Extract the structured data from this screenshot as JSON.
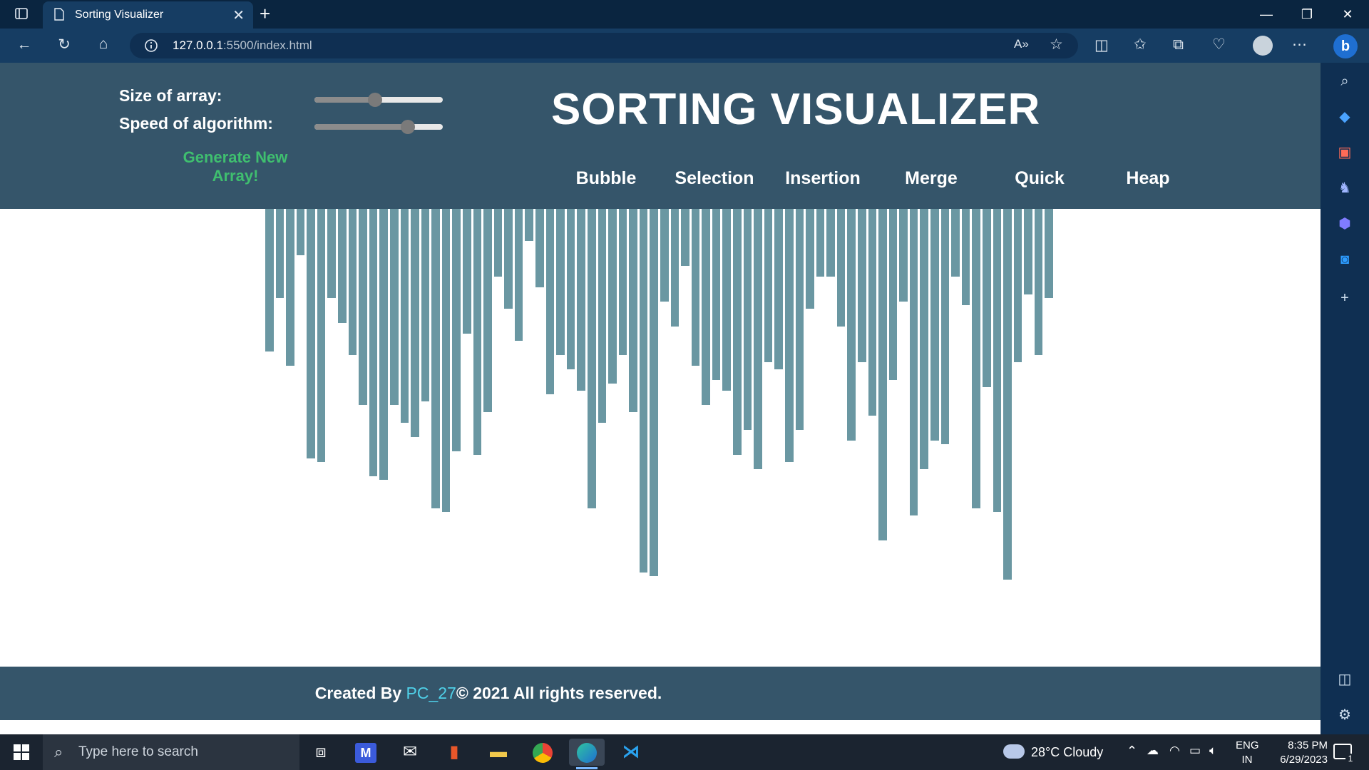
{
  "browser": {
    "tab_title": "Sorting Visualizer",
    "url_host": "127.0.0.1",
    "url_path": ":5500/index.html"
  },
  "header": {
    "size_label": "Size of array:",
    "speed_label": "Speed of algorithm:",
    "size_value": 0.47,
    "speed_value": 0.73,
    "generate_button": "Generate New Array!",
    "title": "SORTING VISUALIZER",
    "algorithms": [
      "Bubble",
      "Selection",
      "Insertion",
      "Merge",
      "Quick",
      "Heap"
    ]
  },
  "bars": [
    200,
    125,
    220,
    65,
    350,
    355,
    125,
    160,
    205,
    275,
    375,
    380,
    275,
    300,
    320,
    270,
    420,
    425,
    340,
    175,
    345,
    285,
    95,
    140,
    185,
    45,
    110,
    260,
    205,
    225,
    255,
    420,
    300,
    245,
    205,
    285,
    510,
    515,
    130,
    165,
    80,
    220,
    275,
    240,
    255,
    345,
    310,
    365,
    215,
    225,
    355,
    310,
    140,
    95,
    95,
    165,
    325,
    215,
    290,
    465,
    240,
    130,
    430,
    365,
    325,
    330,
    95,
    135,
    420,
    250,
    425,
    520,
    215,
    120,
    205,
    125
  ],
  "bar_color": "#6a97a2",
  "footer": {
    "prefix": "Created By ",
    "author": "PC_27",
    "suffix": "© 2021 All rights reserved."
  },
  "taskbar": {
    "search_placeholder": "Type here to search",
    "weather": "28°C  Cloudy",
    "lang_top": "ENG",
    "lang_bottom": "IN",
    "time": "8:35 PM",
    "date": "6/29/2023",
    "notif_count": "1"
  }
}
